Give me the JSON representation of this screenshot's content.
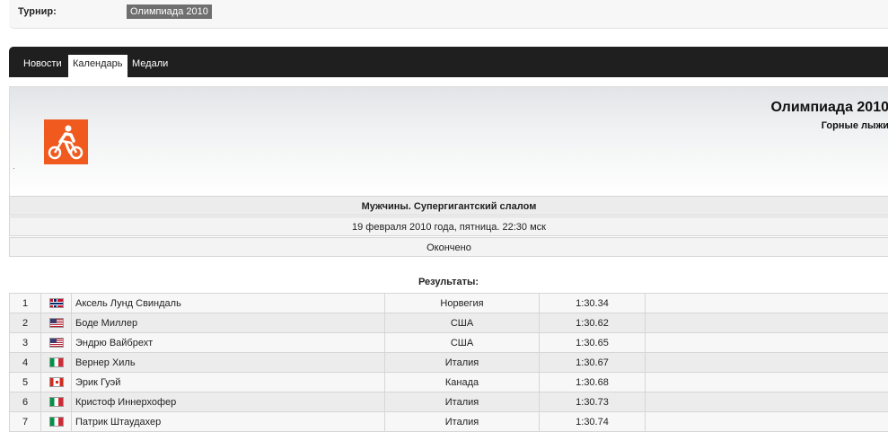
{
  "tournament": {
    "label": "Турнир:",
    "value": "Олимпиада 2010"
  },
  "nav": {
    "tabs": [
      {
        "label": "Новости",
        "active": false
      },
      {
        "label": "Календарь",
        "active": true
      },
      {
        "label": "Медали",
        "active": false
      }
    ]
  },
  "event": {
    "title": "Олимпиада 2010",
    "sport": "Горные лыжи",
    "sport_icon": "cycling-pictogram-icon",
    "icon_color": "#f05a1f"
  },
  "info": {
    "discipline": "Мужчины. Супергигантский слалом",
    "datetime": "19 февраля 2010 года, пятница. 22:30 мск",
    "status": "Окончено"
  },
  "results": {
    "title": "Результаты:",
    "rows": [
      {
        "pos": "1",
        "flag": "norway-flag-icon",
        "name": "Аксель Лунд Свиндаль",
        "country": "Норвегия",
        "time": "1:30.34"
      },
      {
        "pos": "2",
        "flag": "usa-flag-icon",
        "name": "Боде Миллер",
        "country": "США",
        "time": "1:30.62"
      },
      {
        "pos": "3",
        "flag": "usa-flag-icon",
        "name": "Эндрю Вайбрехт",
        "country": "США",
        "time": "1:30.65"
      },
      {
        "pos": "4",
        "flag": "italy-flag-icon",
        "name": "Вернер Хиль",
        "country": "Италия",
        "time": "1:30.67"
      },
      {
        "pos": "5",
        "flag": "canada-flag-icon",
        "name": "Эрик Гуэй",
        "country": "Канада",
        "time": "1:30.68"
      },
      {
        "pos": "6",
        "flag": "italy-flag-icon",
        "name": "Кристоф Иннерхофер",
        "country": "Италия",
        "time": "1:30.73"
      },
      {
        "pos": "7",
        "flag": "italy-flag-icon",
        "name": "Патрик Штаудахер",
        "country": "Италия",
        "time": "1:30.74"
      }
    ]
  }
}
